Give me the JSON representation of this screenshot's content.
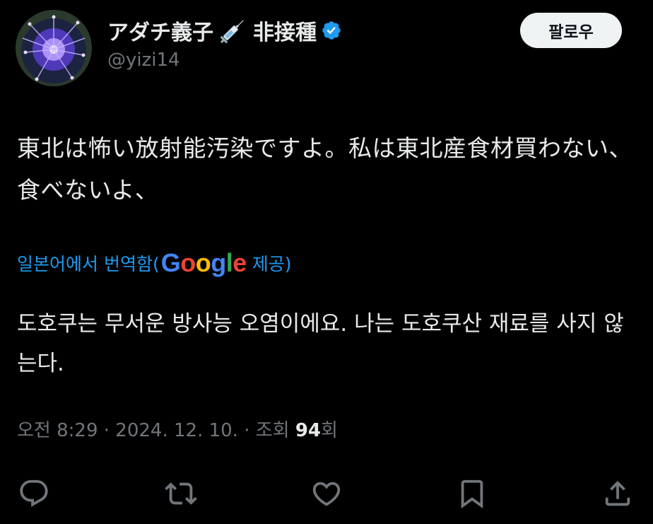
{
  "author": {
    "display_name": "アダチ義子",
    "display_name_suffix": "非接種",
    "handle": "@yizi14",
    "emoji_icon": "syringe-icon",
    "verified_icon": "verified-badge-icon",
    "verified_color": "#1d9bf0"
  },
  "follow_button": {
    "label": "팔로우"
  },
  "tweet": {
    "text": "東北は怖い放射能汚染ですよ。私は東北産食材買わない、食べないよ、"
  },
  "translation": {
    "prefix": "일본어에서 번역함(",
    "provider_logo": {
      "letters": [
        "G",
        "o",
        "o",
        "g",
        "l",
        "e"
      ],
      "colors": [
        "#4285f4",
        "#ea4335",
        "#fbbc05",
        "#4285f4",
        "#34a853",
        "#ea4335"
      ]
    },
    "suffix": "제공)",
    "text": "도호쿠는 무서운 방사능 오염이에요. 나는 도호쿠산 재료를 사지 않는다."
  },
  "meta": {
    "time_date": "오전 8:29 · 2024. 12. 10. · 조회 ",
    "views_count": "94",
    "views_suffix": "회"
  },
  "actions": [
    {
      "name": "reply-icon"
    },
    {
      "name": "retweet-icon"
    },
    {
      "name": "like-icon"
    },
    {
      "name": "bookmark-icon"
    },
    {
      "name": "share-icon"
    }
  ],
  "colors": {
    "background": "#000000",
    "text_primary": "#e7e9ea",
    "text_secondary": "#71767b",
    "link": "#1d9bf0",
    "button_bg": "#eff3f4"
  }
}
